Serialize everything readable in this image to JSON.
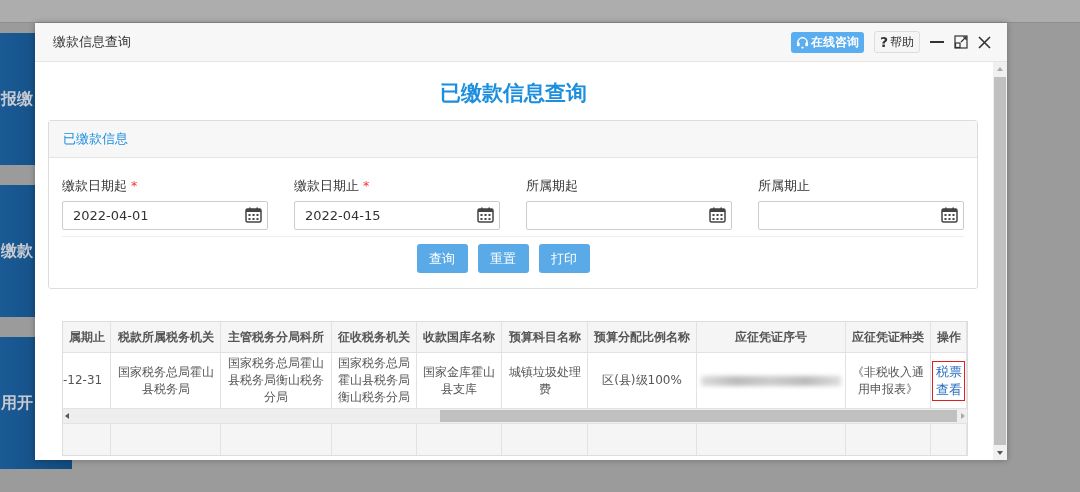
{
  "background": {
    "side_items": [
      {
        "label": "报缴"
      },
      {
        "label": "缴款"
      },
      {
        "label": "用开"
      }
    ]
  },
  "dialog": {
    "title": "缴款信息查询",
    "actions": [
      {
        "kind": "consult",
        "label": "在线咨询"
      },
      {
        "kind": "help",
        "icon": "?",
        "label": "帮助"
      }
    ]
  },
  "heading": "已缴款信息查询",
  "panel": {
    "title": "已缴款信息",
    "fields": [
      {
        "label": "缴款日期起",
        "required_mark": "*",
        "value": "2022-04-01"
      },
      {
        "label": "缴款日期止",
        "required_mark": "*",
        "value": "2022-04-15"
      },
      {
        "label": "所属期起"
      },
      {
        "label": "所属期止"
      }
    ],
    "buttons": [
      "查询",
      "重置",
      "打印"
    ]
  },
  "table": {
    "columns": [
      "属期止",
      "税款所属税务机关",
      "主管税务分局科所",
      "征收税务机关",
      "收款国库名称",
      "预算科目名称",
      "预算分配比例名称",
      "应征凭证序号",
      "应征凭证种类",
      "操作"
    ],
    "rows": [
      {
        "cells": [
          {
            "kind": "text",
            "text": "-12-31"
          },
          {
            "kind": "text",
            "text": "国家税务总局霍山县税务局"
          },
          {
            "kind": "text",
            "text": "国家税务总局霍山县税务局衡山税务分局"
          },
          {
            "kind": "text",
            "text": "国家税务总局霍山县税务局衡山税务分局"
          },
          {
            "kind": "text",
            "text": "国家金库霍山县支库"
          },
          {
            "kind": "text",
            "text": "城镇垃圾处理费"
          },
          {
            "kind": "text",
            "text": "区(县)级100%"
          },
          {
            "kind": "redacted"
          },
          {
            "kind": "text",
            "text": "《非税收入通用申报表》"
          },
          {
            "kind": "link",
            "text": "税票查看",
            "highlighted": true
          }
        ]
      }
    ]
  }
}
